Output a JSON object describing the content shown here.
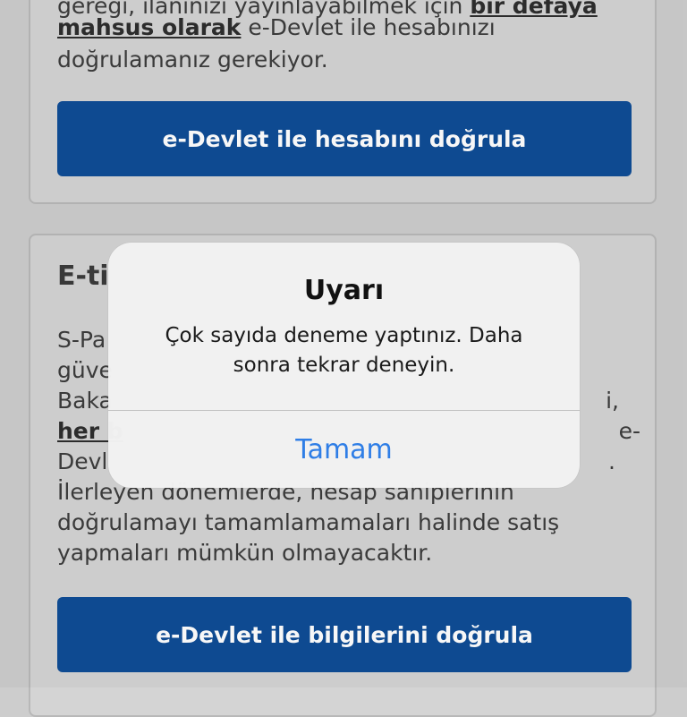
{
  "card1": {
    "line1": "gereği, ilanınızı yayınlayabilmek için ",
    "line1_bold": "bir defaya",
    "line2_bold": "mahsus olarak",
    "line2": " e-Devlet ile hesabınızı",
    "line3": "doğrulamanız gerekiyor.",
    "button": "e-Devlet ile hesabını doğrula"
  },
  "card2": {
    "heading": "E-ti",
    "lines": [
      "S-Pa",
      "güve",
      "Baka",
      "Devl"
    ],
    "line_bold": "her b",
    "frag_right_1": "i,",
    "frag_right_2": "e-",
    "frag_right_3": ".",
    "line5": "İlerleyen dönemlerde, hesap sahiplerinin",
    "line6": "doğrulamayı tamamlamamaları halinde satış",
    "line7": "yapmaları mümkün olmayacaktır.",
    "button": "e-Devlet ile bilgilerini doğrula"
  },
  "alert": {
    "title": "Uyarı",
    "message": "Çok sayıda deneme yaptınız. Daha sonra tekrar deneyin.",
    "ok_label": "Tamam"
  },
  "colors": {
    "primary_button": "#0f4d96",
    "alert_action": "#2f7ee6",
    "background": "#cdcdcd"
  }
}
